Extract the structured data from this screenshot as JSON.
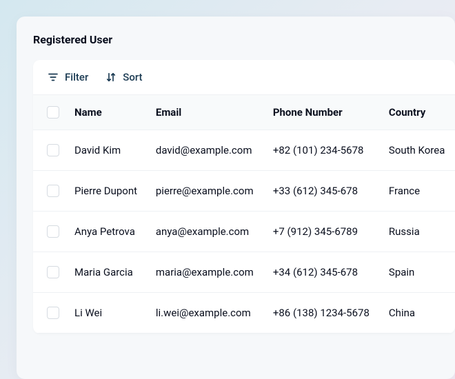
{
  "page": {
    "title": "Registered User"
  },
  "toolbar": {
    "filter_label": "Filter",
    "sort_label": "Sort"
  },
  "table": {
    "columns": {
      "name": "Name",
      "email": "Email",
      "phone": "Phone Number",
      "country": "Country"
    },
    "rows": [
      {
        "name": "David Kim",
        "email": "david@example.com",
        "phone": "+82 (101) 234-5678",
        "country": "South Korea"
      },
      {
        "name": "Pierre Dupont",
        "email": "pierre@example.com",
        "phone": "+33 (612) 345-678",
        "country": "France"
      },
      {
        "name": "Anya Petrova",
        "email": "anya@example.com",
        "phone": "+7 (912) 345-6789",
        "country": "Russia"
      },
      {
        "name": "Maria Garcia",
        "email": "maria@example.com",
        "phone": "+34 (612) 345-678",
        "country": "Spain"
      },
      {
        "name": "Li Wei",
        "email": "li.wei@example.com",
        "phone": "+86 (138) 1234-5678",
        "country": "China"
      }
    ]
  }
}
